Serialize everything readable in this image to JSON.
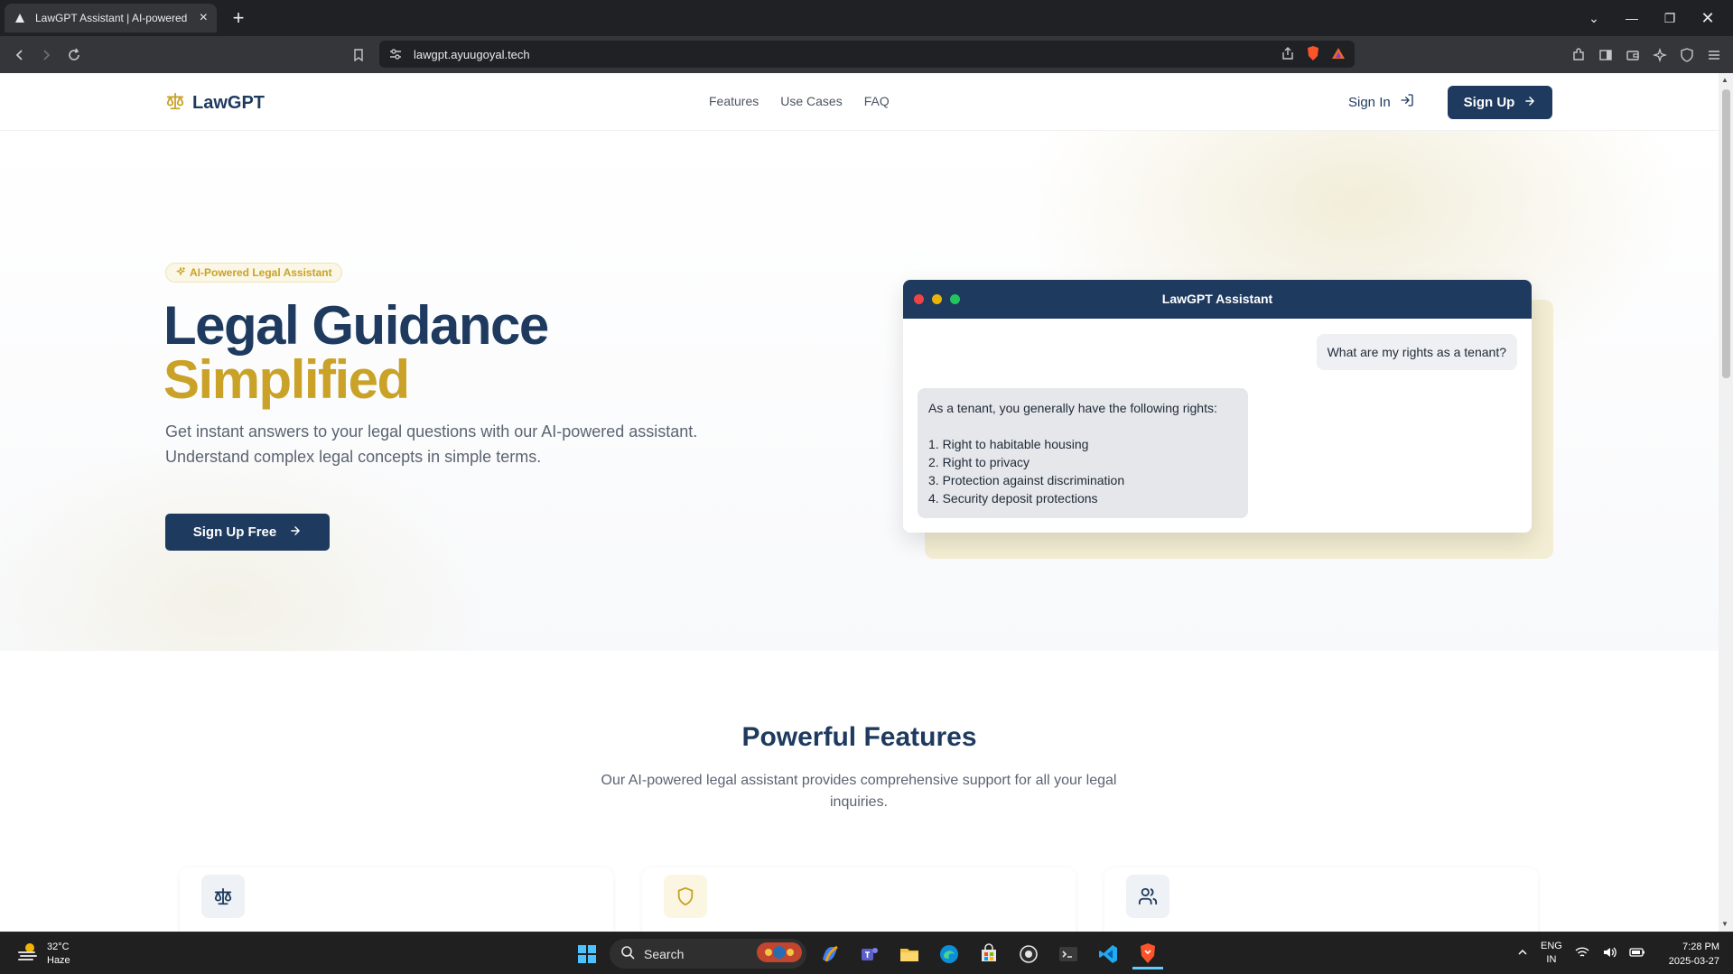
{
  "browser": {
    "tab_title": "LawGPT Assistant | AI-powered",
    "url": "lawgpt.ayuugoyal.tech"
  },
  "nav": {
    "logo": "LawGPT",
    "links": [
      "Features",
      "Use Cases",
      "FAQ"
    ],
    "sign_in": "Sign In",
    "sign_up": "Sign Up"
  },
  "hero": {
    "badge": "AI-Powered Legal Assistant",
    "title_line1": "Legal Guidance",
    "title_line2": "Simplified",
    "subtitle": "Get instant answers to your legal questions with our AI-powered assistant. Understand complex legal concepts in simple terms.",
    "cta": "Sign Up Free"
  },
  "chat_mock": {
    "title": "LawGPT Assistant",
    "user_message": "What are my rights as a tenant?",
    "bot_intro": "As a tenant, you generally have the following rights:",
    "bot_items": [
      "1. Right to habitable housing",
      "2. Right to privacy",
      "3. Protection against discrimination",
      "4. Security deposit protections"
    ]
  },
  "features": {
    "title": "Powerful Features",
    "subtitle": "Our AI-powered legal assistant provides comprehensive support for all your legal inquiries.",
    "cards": [
      {
        "icon": "scale-icon"
      },
      {
        "icon": "shield-icon"
      },
      {
        "icon": "users-icon"
      }
    ]
  },
  "taskbar": {
    "temperature": "32°C",
    "condition": "Haze",
    "search_placeholder": "Search",
    "lang_line1": "ENG",
    "lang_line2": "IN",
    "time": "7:28 PM",
    "date": "2025-03-27"
  },
  "colors": {
    "navy": "#1e3a5f",
    "gold": "#c9a227"
  }
}
